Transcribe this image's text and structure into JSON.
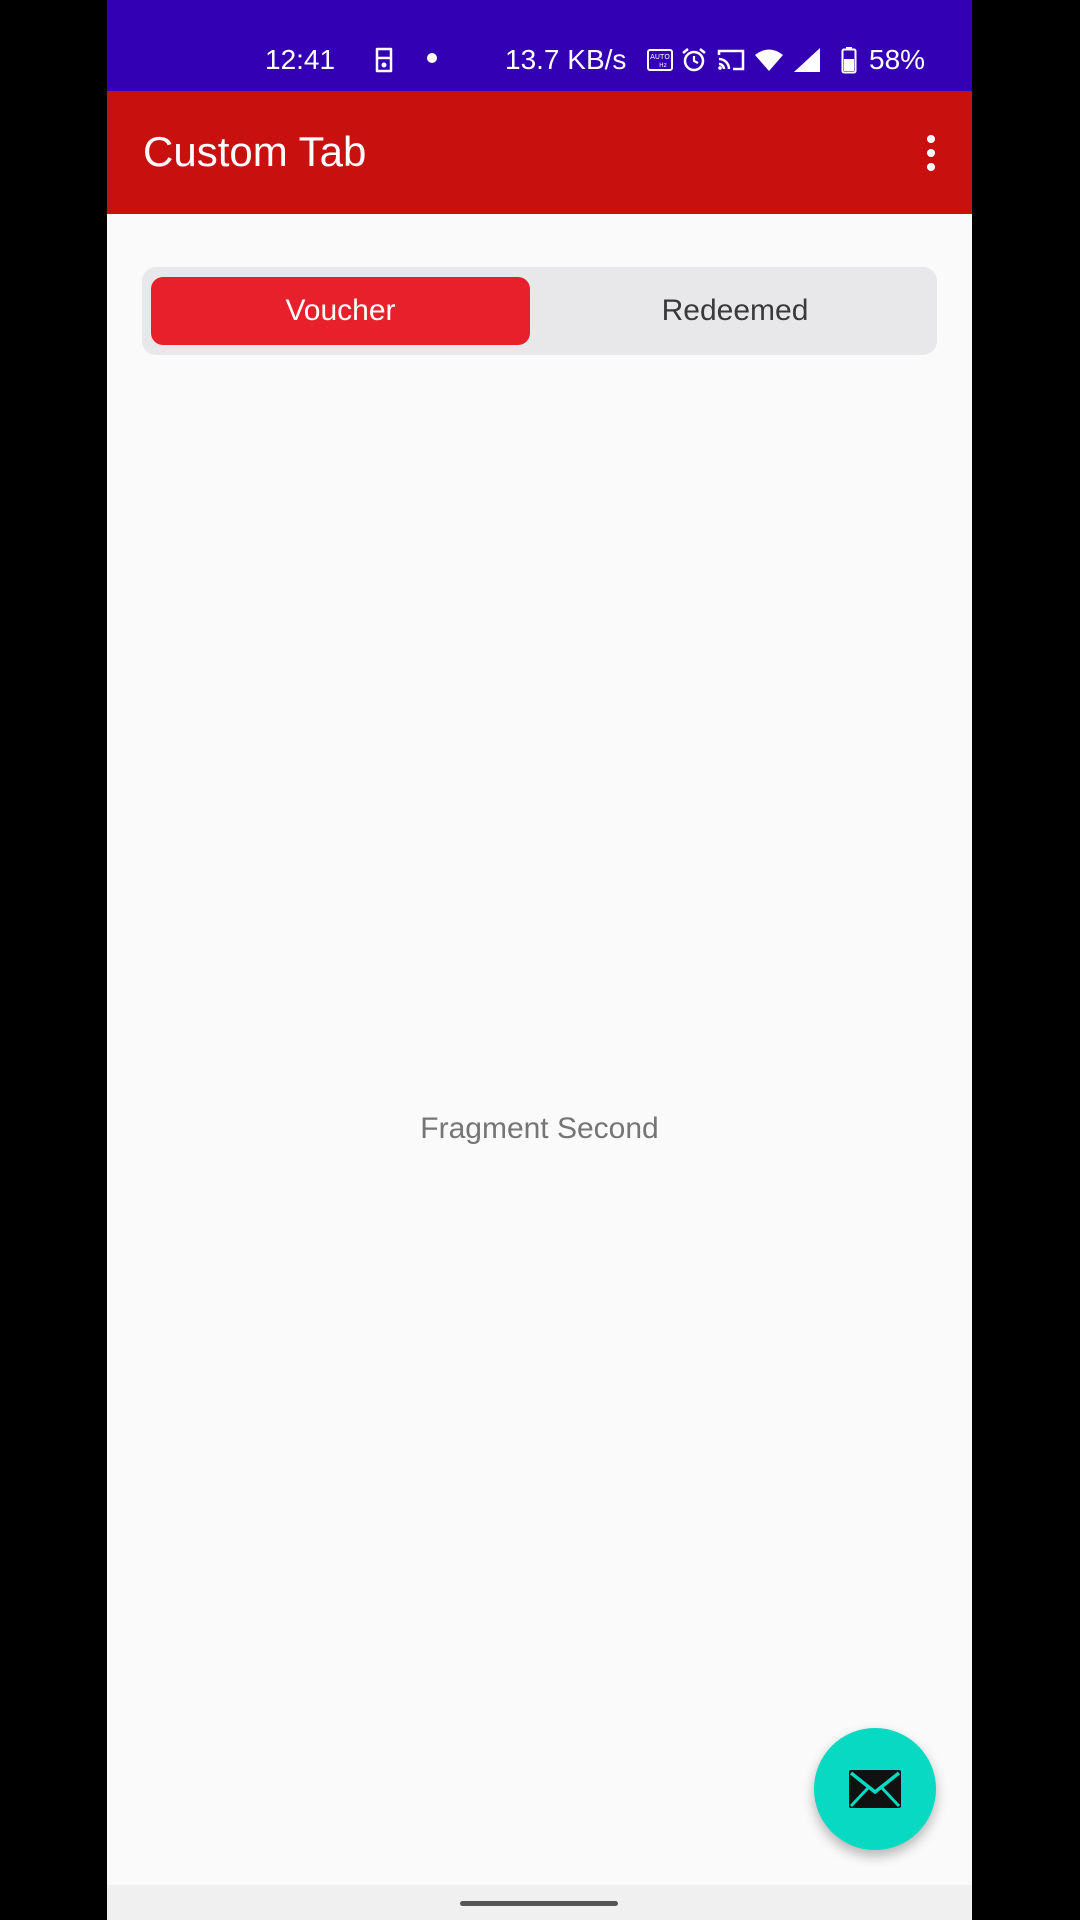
{
  "status_bar": {
    "time": "12:41",
    "network_speed": "13.7 KB/s",
    "battery": "58%",
    "icons": [
      "face-unlock-icon",
      "notification-dot",
      "auto-hz-icon",
      "alarm-icon",
      "cast-icon",
      "wifi-icon",
      "signal-icon",
      "battery-icon"
    ]
  },
  "app_bar": {
    "title": "Custom Tab",
    "menu_icon": "more-vert-icon"
  },
  "tabs": [
    {
      "label": "Voucher",
      "selected": true
    },
    {
      "label": "Redeemed",
      "selected": false
    }
  ],
  "content": {
    "text": "Fragment Second"
  },
  "fab": {
    "icon": "mail-icon"
  },
  "colors": {
    "status_bar": "#3300b3",
    "app_bar": "#c8100f",
    "tab_active": "#e8202b",
    "tab_track": "#e8e8ea",
    "fab": "#07d9c3"
  }
}
